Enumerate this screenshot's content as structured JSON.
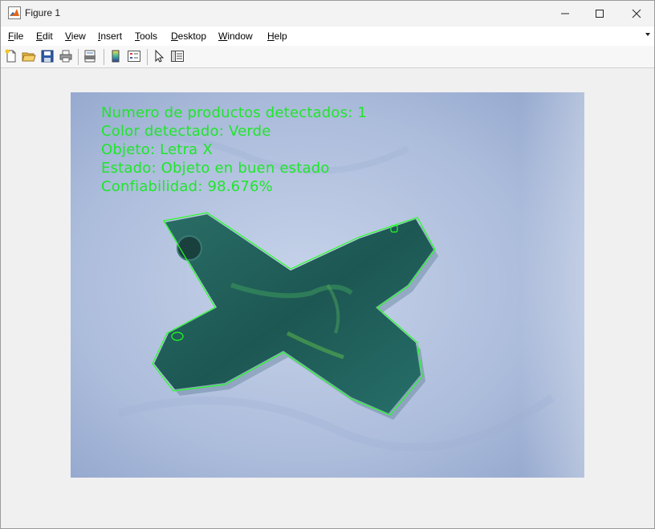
{
  "window": {
    "title": "Figure 1",
    "icon": "matlab-logo-icon"
  },
  "menu": {
    "items": [
      "File",
      "Edit",
      "View",
      "Insert",
      "Tools",
      "Desktop",
      "Window",
      "Help"
    ]
  },
  "toolbar": {
    "buttons": [
      "new-figure-icon",
      "open-file-icon",
      "save-icon",
      "print-icon",
      "print-preview-icon",
      "colorbar-icon",
      "legend-icon",
      "pointer-icon",
      "property-inspector-icon"
    ]
  },
  "image": {
    "overlay_lines": [
      "Numero de productos detectados: 1",
      "Color detectado: Verde",
      "Objeto: Letra X",
      "Estado: Objeto en buen estado",
      "Confiabilidad: 98.676%"
    ],
    "overlay_color": "#1ee62a",
    "contour_color": "#22ff22",
    "object_color": "#1f5a55",
    "background_color": "#a9b9d9"
  }
}
